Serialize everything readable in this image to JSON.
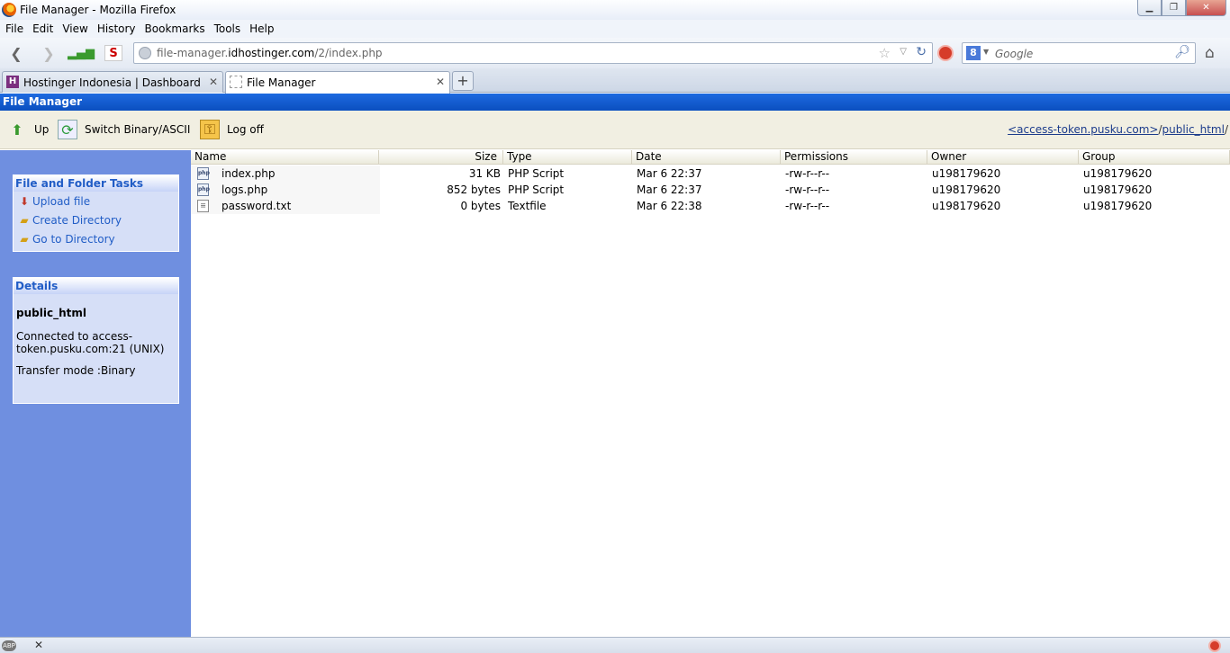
{
  "window": {
    "title": "File Manager - Mozilla Firefox"
  },
  "menu": [
    "File",
    "Edit",
    "View",
    "History",
    "Bookmarks",
    "Tools",
    "Help"
  ],
  "nav": {
    "url_prefix": "file-manager.",
    "url_host": "idhostinger.com",
    "url_path": "/2/index.php",
    "search_placeholder": "Google",
    "search_engine_letter": "8"
  },
  "tabs": [
    {
      "label": "Hostinger Indonesia | Dashboard",
      "active": false
    },
    {
      "label": "File Manager",
      "active": true
    }
  ],
  "app": {
    "header": "File Manager",
    "toolbar": {
      "up": "Up",
      "switch": "Switch Binary/ASCII",
      "logoff": "Log off"
    },
    "breadcrumb": {
      "host": "<access-token.pusku.com>",
      "sep": "/",
      "dir": "public_html",
      "trail": "/"
    }
  },
  "sidebar": {
    "tasks_title": "File and Folder Tasks",
    "tasks": [
      "Upload file",
      "Create Directory",
      "Go to Directory"
    ],
    "details_title": "Details",
    "details": {
      "folder": "public_html",
      "connection": "Connected to access-token.pusku.com:21 (UNIX)",
      "transfer": "Transfer mode :Binary"
    }
  },
  "columns": [
    "Name",
    "Size",
    "Type",
    "Date",
    "Permissions",
    "Owner",
    "Group"
  ],
  "files": [
    {
      "icon": "php",
      "name": "index.php",
      "size": "31 KB",
      "type": "PHP Script",
      "date": "Mar 6 22:37",
      "perms": "-rw-r--r--",
      "owner": "u198179620",
      "group": "u198179620"
    },
    {
      "icon": "php",
      "name": "logs.php",
      "size": "852 bytes",
      "type": "PHP Script",
      "date": "Mar 6 22:37",
      "perms": "-rw-r--r--",
      "owner": "u198179620",
      "group": "u198179620"
    },
    {
      "icon": "txt",
      "name": "password.txt",
      "size": "0 bytes",
      "type": "Textfile",
      "date": "Mar 6 22:38",
      "perms": "-rw-r--r--",
      "owner": "u198179620",
      "group": "u198179620"
    }
  ],
  "icons": {
    "php_badge": "php",
    "abp_badge": "ABP"
  }
}
